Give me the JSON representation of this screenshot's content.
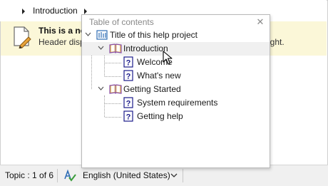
{
  "breadcrumb": {
    "current": "Introduction"
  },
  "banner": {
    "title": "This is a no",
    "text": "Header displa",
    "text_tail": "right.",
    "color": "#fbf7d8"
  },
  "toc": {
    "title": "Table of contents",
    "close_label": "✕",
    "items": [
      {
        "label": "Title of this help project",
        "icon": "project-title-icon"
      },
      {
        "label": "Introduction",
        "icon": "book-open-icon",
        "expanded": true
      },
      {
        "label": "Welcome",
        "icon": "help-topic-icon"
      },
      {
        "label": "What's new",
        "icon": "help-topic-icon"
      },
      {
        "label": "Getting Started",
        "icon": "book-open-icon",
        "expanded": true
      },
      {
        "label": "System requirements",
        "icon": "help-topic-icon"
      },
      {
        "label": "Getting help",
        "icon": "help-topic-icon"
      }
    ]
  },
  "statusbar": {
    "topic": "Topic : 1 of 6",
    "language": "English (United States)"
  }
}
